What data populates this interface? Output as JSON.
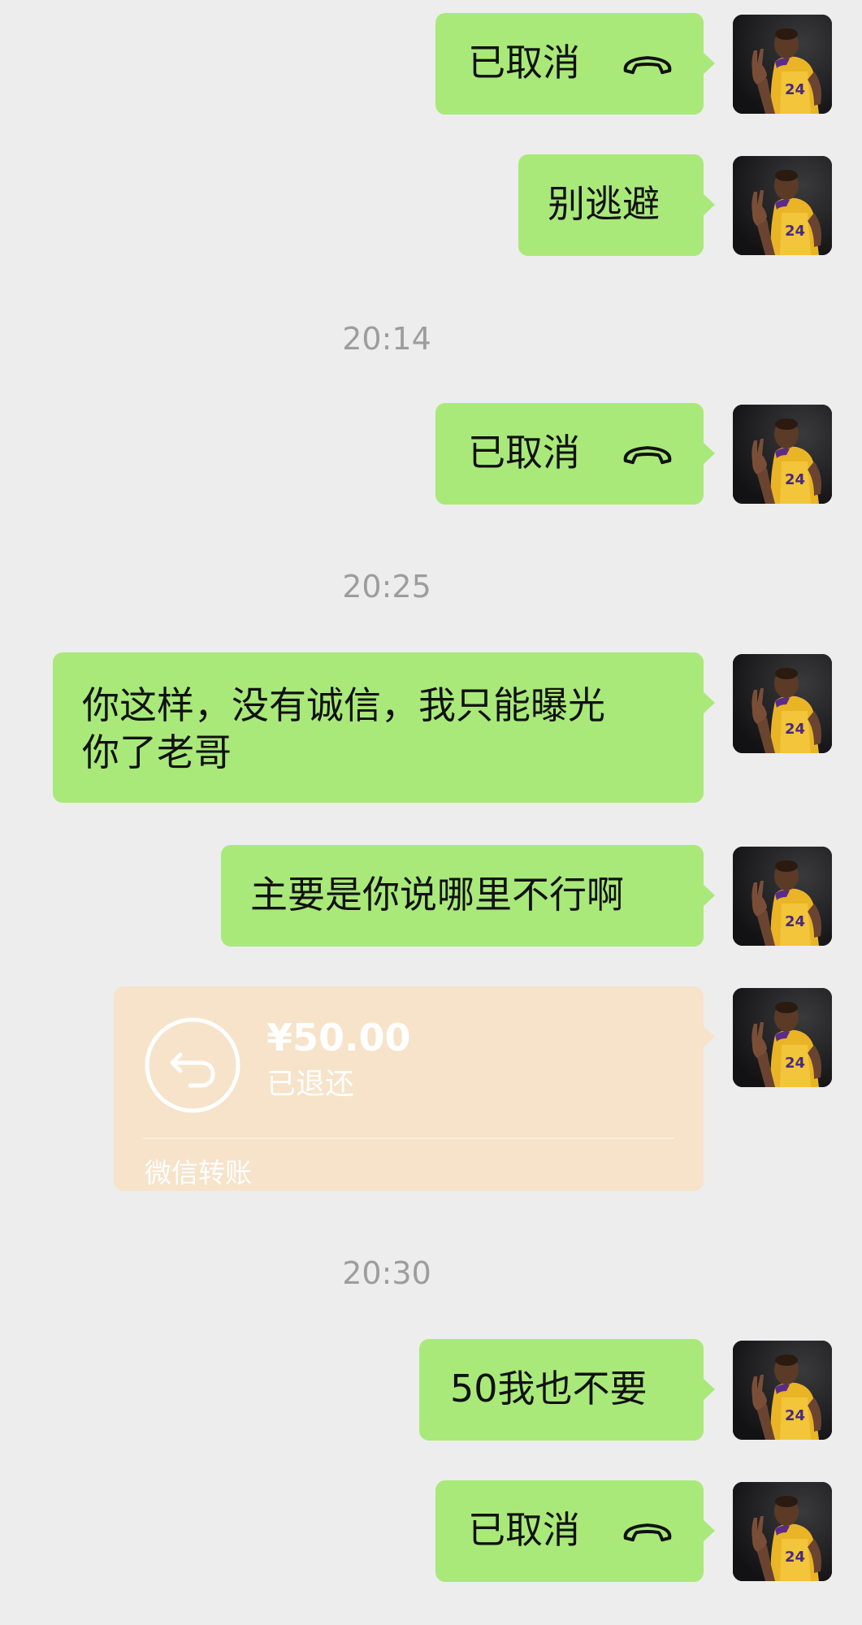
{
  "colors": {
    "background": "#ededed",
    "bubble_green": "#a9e97a",
    "transfer_bg": "#f6e3c9",
    "timestamp": "#9d9d9d"
  },
  "messages": [
    {
      "type": "call",
      "text": "已取消",
      "icon": "phone-hangup-icon"
    },
    {
      "type": "text",
      "text": "别逃避"
    },
    {
      "type": "time",
      "text": "20:14"
    },
    {
      "type": "call",
      "text": "已取消",
      "icon": "phone-hangup-icon"
    },
    {
      "type": "time",
      "text": "20:25"
    },
    {
      "type": "text",
      "text": "你这样，没有诚信，我只能曝光\n你了老哥"
    },
    {
      "type": "text",
      "text": "主要是你说哪里不行啊"
    },
    {
      "type": "transfer",
      "amount": "¥50.00",
      "status": "已退还",
      "label": "微信转账",
      "icon": "return-arrow-icon"
    },
    {
      "type": "time",
      "text": "20:30"
    },
    {
      "type": "text",
      "text": "50我也不要"
    },
    {
      "type": "call",
      "text": "已取消",
      "icon": "phone-hangup-icon"
    }
  ]
}
